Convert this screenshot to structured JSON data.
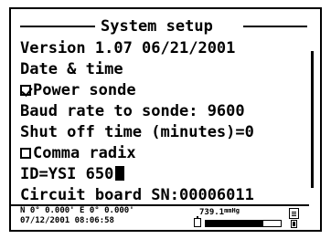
{
  "screen": {
    "title": "System setup",
    "items": [
      {
        "label": "Version 1.07 06/21/2001",
        "type": "text"
      },
      {
        "label": "Date & time",
        "type": "text"
      },
      {
        "label": "Power sonde",
        "type": "checkbox",
        "checked": true
      },
      {
        "label": "Baud rate to sonde: 9600",
        "type": "text"
      },
      {
        "label": "Shut off time (minutes)=0",
        "type": "text"
      },
      {
        "label": "Comma radix",
        "type": "checkbox",
        "checked": false
      },
      {
        "label": "ID=YSI 650",
        "type": "input"
      },
      {
        "label": "Circuit board SN:00006011",
        "type": "text"
      }
    ]
  },
  "status": {
    "coords": "N 0° 0.000' E 0° 0.000'",
    "datetime": "07/12/2001 08:06:58",
    "pressure_value": "739.1",
    "pressure_unit": "mmHg",
    "battery_level": 0.77,
    "icons": [
      "battery-icon",
      "document-icon",
      "plug-icon"
    ]
  },
  "colors": {
    "foreground": "#000000",
    "background": "#ffffff"
  }
}
